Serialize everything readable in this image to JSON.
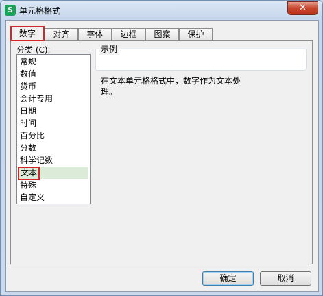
{
  "window": {
    "app_icon": "S",
    "title": "单元格格式",
    "close_label": "✕"
  },
  "tabs": [
    {
      "label": "数字",
      "active": true
    },
    {
      "label": "对齐"
    },
    {
      "label": "字体"
    },
    {
      "label": "边框"
    },
    {
      "label": "图案"
    },
    {
      "label": "保护"
    }
  ],
  "category": {
    "label": "分类 (C):",
    "items": [
      "常规",
      "数值",
      "货币",
      "会计专用",
      "日期",
      "时间",
      "百分比",
      "分数",
      "科学记数",
      "文本",
      "特殊",
      "自定义"
    ],
    "selected": "文本"
  },
  "sample": {
    "legend": "示例"
  },
  "description": "在文本单元格格式中，数字作为文本处理。",
  "buttons": {
    "ok": "确定",
    "cancel": "取消"
  },
  "colors": {
    "highlight_border": "#d7262b",
    "selected_bg": "#dcebd8"
  }
}
